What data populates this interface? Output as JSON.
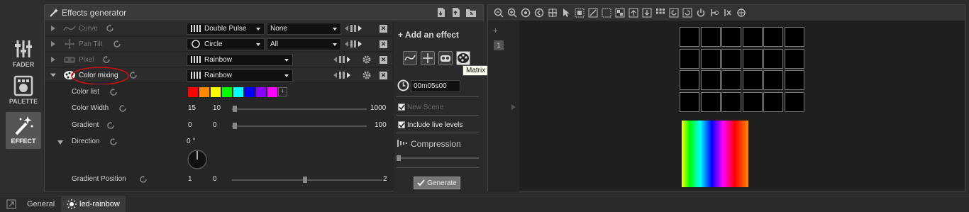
{
  "left_tools": [
    {
      "label": "FADER",
      "icon": "fader-icon"
    },
    {
      "label": "PALETTE",
      "icon": "palette-icon"
    },
    {
      "label": "EFFECT",
      "icon": "magic-wand-icon",
      "active": true
    }
  ],
  "panel": {
    "title": "Effects generator",
    "effects": [
      {
        "name": "Curve",
        "icon": "curve-icon",
        "combo1": "Double Pulse",
        "combo2": "None",
        "dim": true
      },
      {
        "name": "Pan Tilt",
        "icon": "pan-tilt-icon",
        "combo1": "Circle",
        "combo2": "All",
        "dim": true
      },
      {
        "name": "Pixel",
        "icon": "pixel-icon",
        "combo1": "Rainbow",
        "dim": true
      },
      {
        "name": "Color mixing",
        "icon": "palette-icon",
        "combo1": "Rainbow",
        "dim": false
      }
    ],
    "params": {
      "color_list_label": "Color list",
      "color_width": {
        "label": "Color Width",
        "v1": "15",
        "v2": "10",
        "max": "1000"
      },
      "gradient": {
        "label": "Gradient",
        "v1": "0",
        "v2": "0",
        "max": "100"
      },
      "direction": {
        "label": "Direction",
        "value": "0 °"
      },
      "gradient_position": {
        "label": "Gradient Position",
        "v1": "1",
        "v2": "0",
        "max": "2"
      }
    },
    "colors": [
      "#ff0000",
      "#ff8800",
      "#ffff00",
      "#00ff00",
      "#00ffff",
      "#0000ff",
      "#8800ff",
      "#ff00ff"
    ]
  },
  "add_effect": {
    "title": "Add an effect",
    "time": "00m05s00",
    "new_scene": "New Scene",
    "include_live": "Include live levels",
    "compression": "Compression",
    "generate": "Generate",
    "tooltip": "Matrix effect"
  },
  "preview": {
    "side_number": "1"
  },
  "tabs": [
    {
      "label": "General"
    },
    {
      "label": "led-rainbow",
      "active": true
    }
  ]
}
